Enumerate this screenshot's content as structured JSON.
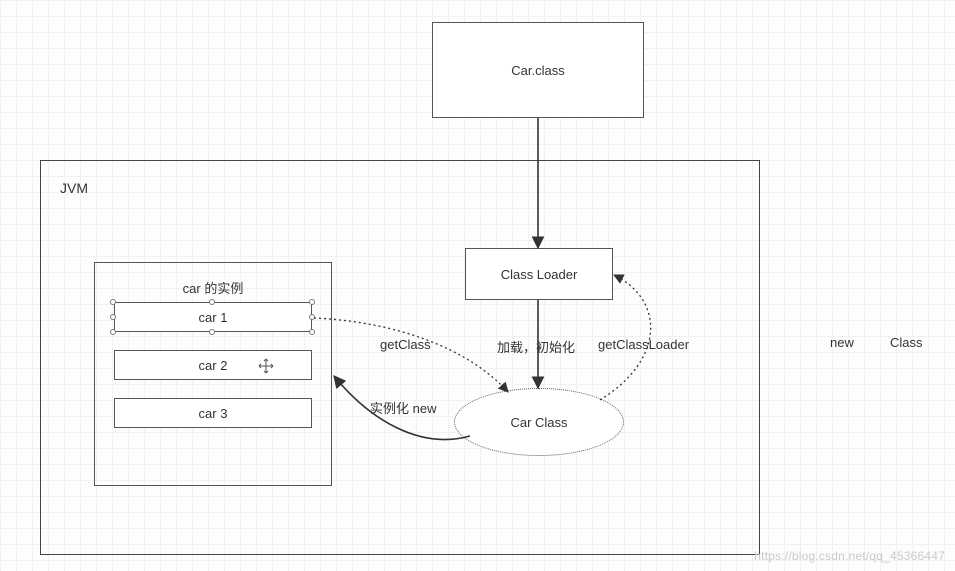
{
  "diagram": {
    "car_file": "Car.class",
    "jvm_label": "JVM",
    "class_loader": "Class Loader",
    "car_class": "Car Class",
    "instances_title": "car 的实例",
    "instances": {
      "i1": "car 1",
      "i2": "car 2",
      "i3": "car 3"
    },
    "labels": {
      "get_class": "getClass",
      "load_init": "加载，初始化",
      "get_class_loader": "getClassLoader",
      "instantiate": "实例化 new"
    },
    "side": {
      "new": "new",
      "class": "Class"
    },
    "watermark": "https://blog.csdn.net/qq_45366447"
  }
}
